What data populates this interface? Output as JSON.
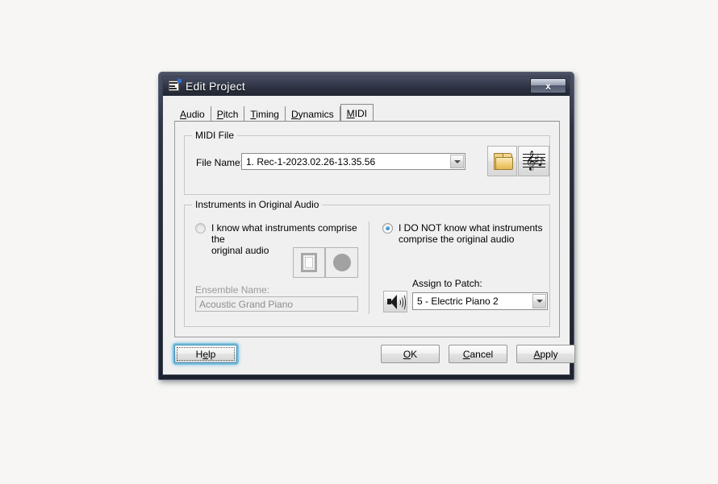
{
  "window": {
    "title": "Edit Project",
    "icon": "project-app-icon",
    "close_label": "x"
  },
  "tabs": [
    {
      "name": "audio",
      "label": "Audio",
      "mnemonic": "A",
      "rest": "udio",
      "active": false
    },
    {
      "name": "pitch",
      "label": "Pitch",
      "mnemonic": "P",
      "rest": "itch",
      "active": false
    },
    {
      "name": "timing",
      "label": "Timing",
      "mnemonic": "T",
      "rest": "iming",
      "active": false
    },
    {
      "name": "dynamics",
      "label": "Dynamics",
      "mnemonic": "D",
      "rest": "ynamics",
      "active": false
    },
    {
      "name": "midi",
      "label": "MIDI",
      "mnemonic": "M",
      "rest": "IDI",
      "active": true
    }
  ],
  "midi_file": {
    "group_title": "MIDI File",
    "file_name_label": "File Name:",
    "file_name_value": "1. Rec-1-2023.02.26-13.35.56",
    "browse_button_tooltip": "Browse",
    "score_button_tooltip": "Open Score"
  },
  "instruments": {
    "group_title": "Instruments in Original Audio",
    "radio_know": {
      "label": "I know what instruments comprise the original audio",
      "line1": "I know what instruments comprise the",
      "line2": "original audio",
      "selected": false,
      "enabled": false
    },
    "radio_dont_know": {
      "label": "I DO NOT know what instruments comprise the original audio",
      "line1": "I DO NOT know what instruments",
      "line2": "comprise the original audio",
      "selected": true,
      "enabled": true
    },
    "ensemble_label": "Ensemble Name:",
    "ensemble_value": "Acoustic Grand Piano",
    "ensemble_enabled": false,
    "assign_patch_label": "Assign to Patch:",
    "assign_patch_value": "5 - Electric Piano 2",
    "preview_button_tooltip": "Preview Patch"
  },
  "buttons": {
    "help": {
      "mnemonic_pre": "H",
      "mnemonic": "e",
      "mnemonic_post": "lp",
      "label": "Help",
      "focused": true
    },
    "ok": {
      "mnemonic_pre": "",
      "mnemonic": "O",
      "mnemonic_post": "K",
      "label": "OK",
      "focused": false
    },
    "cancel": {
      "mnemonic_pre": "",
      "mnemonic": "C",
      "mnemonic_post": "ancel",
      "label": "Cancel",
      "focused": false
    },
    "apply": {
      "mnemonic_pre": "",
      "mnemonic": "A",
      "mnemonic_post": "pply",
      "label": "Apply",
      "focused": false
    }
  },
  "colors": {
    "accent_focus": "#3c8dbc",
    "titlebar_dark": "#2b3140",
    "dialog_face": "#f0f0f0",
    "page_background": "#f7f6f4",
    "radio_dot": "#2f8dc4",
    "folder_yellow": "#e9c469"
  }
}
